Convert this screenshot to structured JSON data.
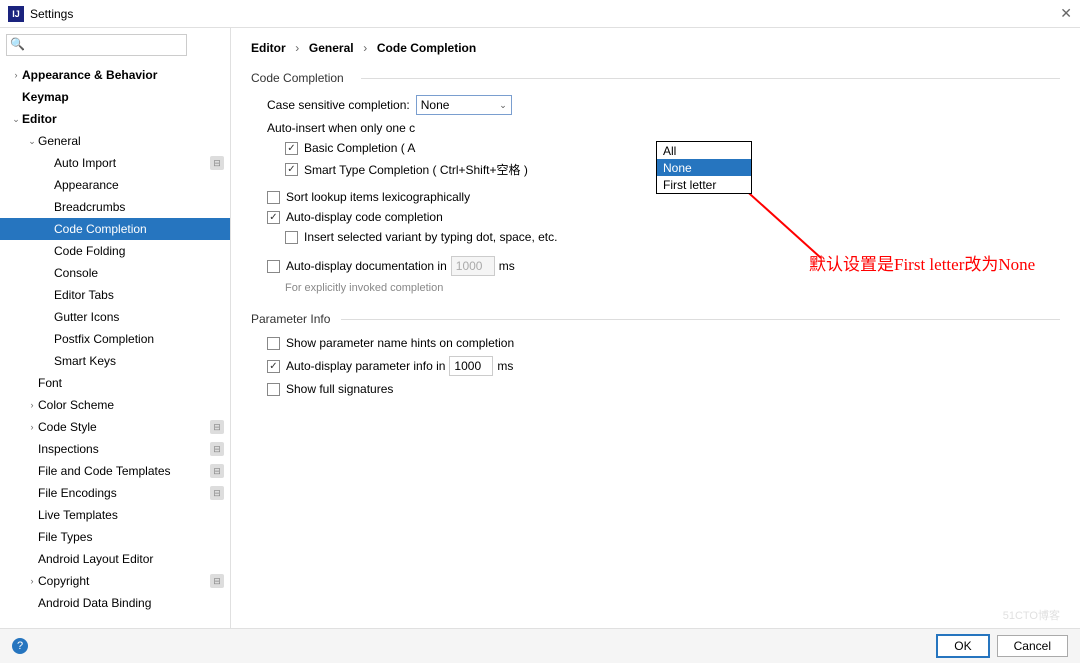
{
  "window": {
    "title": "Settings",
    "close": "✕",
    "app_icon": "IJ"
  },
  "search": {
    "placeholder": ""
  },
  "tree": [
    {
      "lbl": "Appearance & Behavior",
      "lvl": 0,
      "exp": "›",
      "bold": true
    },
    {
      "lbl": "Keymap",
      "lvl": 0,
      "exp": "",
      "bold": true
    },
    {
      "lbl": "Editor",
      "lvl": 0,
      "exp": "⌄",
      "bold": true
    },
    {
      "lbl": "General",
      "lvl": 1,
      "exp": "⌄"
    },
    {
      "lbl": "Auto Import",
      "lvl": 2,
      "exp": "",
      "badge": true
    },
    {
      "lbl": "Appearance",
      "lvl": 2,
      "exp": ""
    },
    {
      "lbl": "Breadcrumbs",
      "lvl": 2,
      "exp": ""
    },
    {
      "lbl": "Code Completion",
      "lvl": 2,
      "exp": "",
      "selected": true
    },
    {
      "lbl": "Code Folding",
      "lvl": 2,
      "exp": ""
    },
    {
      "lbl": "Console",
      "lvl": 2,
      "exp": ""
    },
    {
      "lbl": "Editor Tabs",
      "lvl": 2,
      "exp": ""
    },
    {
      "lbl": "Gutter Icons",
      "lvl": 2,
      "exp": ""
    },
    {
      "lbl": "Postfix Completion",
      "lvl": 2,
      "exp": ""
    },
    {
      "lbl": "Smart Keys",
      "lvl": 2,
      "exp": ""
    },
    {
      "lbl": "Font",
      "lvl": 1,
      "exp": ""
    },
    {
      "lbl": "Color Scheme",
      "lvl": 1,
      "exp": "›"
    },
    {
      "lbl": "Code Style",
      "lvl": 1,
      "exp": "›",
      "badge": true
    },
    {
      "lbl": "Inspections",
      "lvl": 1,
      "exp": "",
      "badge": true
    },
    {
      "lbl": "File and Code Templates",
      "lvl": 1,
      "exp": "",
      "badge": true
    },
    {
      "lbl": "File Encodings",
      "lvl": 1,
      "exp": "",
      "badge": true
    },
    {
      "lbl": "Live Templates",
      "lvl": 1,
      "exp": ""
    },
    {
      "lbl": "File Types",
      "lvl": 1,
      "exp": ""
    },
    {
      "lbl": "Android Layout Editor",
      "lvl": 1,
      "exp": ""
    },
    {
      "lbl": "Copyright",
      "lvl": 1,
      "exp": "›",
      "badge": true
    },
    {
      "lbl": "Android Data Binding",
      "lvl": 1,
      "exp": ""
    }
  ],
  "breadcrumb": {
    "a": "Editor",
    "b": "General",
    "c": "Code Completion",
    "sep": "›"
  },
  "sections": {
    "cc": "Code Completion",
    "case_label": "Case sensitive completion:",
    "case_value": "None",
    "dropdown": [
      "All",
      "None",
      "First letter"
    ],
    "auto_insert": "Auto-insert when only one c",
    "basic": "Basic Completion ( A",
    "smart": "Smart Type Completion ( Ctrl+Shift+空格 )",
    "sort": "Sort lookup items lexicographically",
    "autodisp": "Auto-display code completion",
    "insertvar": "Insert selected variant by typing dot, space, etc.",
    "autodoc": "Auto-display documentation in",
    "autodoc_val": "1000",
    "ms": "ms",
    "autodoc_hint": "For explicitly invoked completion",
    "pi": "Parameter Info",
    "pi_hints": "Show parameter name hints on completion",
    "pi_auto": "Auto-display parameter info in",
    "pi_auto_val": "1000",
    "pi_full": "Show full signatures"
  },
  "annotation": "默认设置是First letter改为None",
  "footer": {
    "ok": "OK",
    "cancel": "Cancel",
    "help": "?"
  },
  "watermark": "51CTO博客"
}
